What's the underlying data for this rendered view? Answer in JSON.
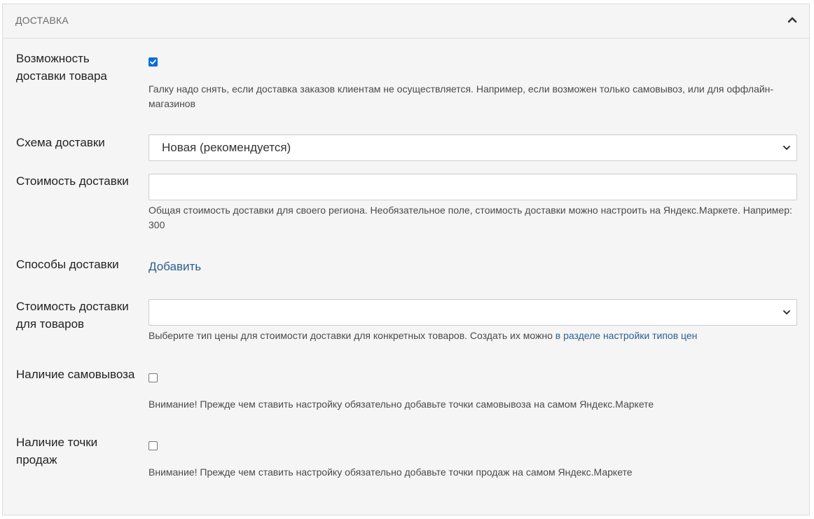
{
  "panel": {
    "title": "ДОСТАВКА"
  },
  "delivery_possible": {
    "label": "Возможность доставки товара",
    "checked": true,
    "help": "Галку надо снять, если доставка заказов клиентам не осуществляется. Например, если возможен только самовывоз, или для оффлайн-магазинов"
  },
  "delivery_scheme": {
    "label": "Схема доставки",
    "selected": "Новая (рекомендуется)"
  },
  "delivery_cost": {
    "label": "Стоимость доставки",
    "value": "",
    "help": "Общая стоимость доставки для своего региона. Необязательное поле, стоимость доставки можно настроить на Яндекс.Маркете. Например: 300"
  },
  "delivery_methods": {
    "label": "Способы доставки",
    "add_link": "Добавить"
  },
  "product_delivery_cost": {
    "label": "Стоимость доставки для товаров",
    "selected": "",
    "help_text": "Выберите тип цены для стоимости доставки для конкретных товаров. Создать их можно ",
    "help_link": "в разделе настройки типов цен"
  },
  "pickup": {
    "label": "Наличие самовывоза",
    "checked": false,
    "help": "Внимание! Прежде чем ставить настройку обязательно добавьте точки самовывоза на самом Яндекс.Маркете"
  },
  "sales_point": {
    "label": "Наличие точки продаж",
    "checked": false,
    "help": "Внимание! Прежде чем ставить настройку обязательно добавьте точки продаж на самом Яндекс.Маркете"
  },
  "icons": {
    "collapse": "chevron-up-icon",
    "select": "chevron-down-icon",
    "check": "check-icon"
  },
  "colors": {
    "panel_bg": "#f5f5f5",
    "link": "#2c5e8f",
    "checkbox_checked": "#0b6cdc"
  }
}
